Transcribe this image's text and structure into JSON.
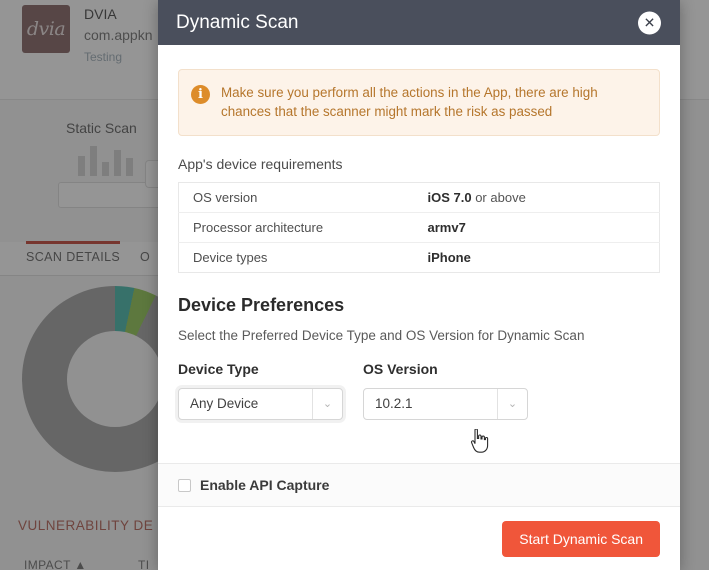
{
  "background": {
    "app_icon_text": "dvia",
    "app_name": "DVIA",
    "app_package": "com.appkn",
    "app_sub": "Testing",
    "static_scan_label": "Static Scan",
    "tabs": [
      {
        "label": "SCAN DETAILS"
      },
      {
        "label": "O"
      }
    ],
    "vulnerability_title": "VULNERABILITY DE",
    "column_impact": "IMPACT ▲",
    "column_title": "TI"
  },
  "modal": {
    "title": "Dynamic Scan",
    "close_icon": "✕",
    "alert": {
      "icon": "i",
      "text": "Make sure you perform all the actions in the App, there are high chances that the scanner might mark the risk as passed"
    },
    "requirements_label": "App's device requirements",
    "requirements": [
      {
        "label": "OS version",
        "value": "iOS 7.0",
        "suffix": "or above"
      },
      {
        "label": "Processor architecture",
        "value": "armv7",
        "suffix": ""
      },
      {
        "label": "Device types",
        "value": "iPhone",
        "suffix": ""
      }
    ],
    "preferences": {
      "heading": "Device Preferences",
      "description": "Select the Preferred Device Type and OS Version for Dynamic Scan",
      "device_type_label": "Device Type",
      "device_type_value": "Any Device",
      "os_version_label": "OS Version",
      "os_version_value": "10.2.1",
      "chevron": "⌄"
    },
    "api_capture_label": "Enable API Capture",
    "start_button": "Start Dynamic Scan"
  },
  "colors": {
    "header_bg": "#4a4f5c",
    "accent": "#f0563a",
    "alert_bg": "#fdf3e9",
    "alert_text": "#b5762c",
    "alert_icon": "#dd8c2a"
  }
}
